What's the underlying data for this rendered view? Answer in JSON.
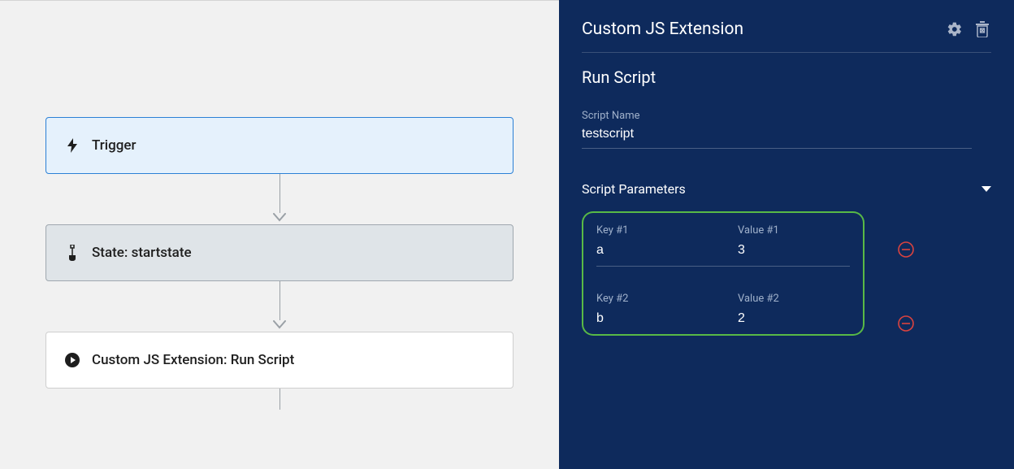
{
  "flow": {
    "trigger_label": "Trigger",
    "state_label": "State: startstate",
    "action_label": "Custom JS Extension: Run Script"
  },
  "panel": {
    "title": "Custom JS Extension",
    "subtitle": "Run Script",
    "script_name_label": "Script Name",
    "script_name_value": "testscript",
    "params_label": "Script Parameters",
    "params": [
      {
        "key_label": "Key #1",
        "key": "a",
        "value_label": "Value #1",
        "value": "3"
      },
      {
        "key_label": "Key #2",
        "key": "b",
        "value_label": "Value #2",
        "value": "2"
      }
    ]
  }
}
